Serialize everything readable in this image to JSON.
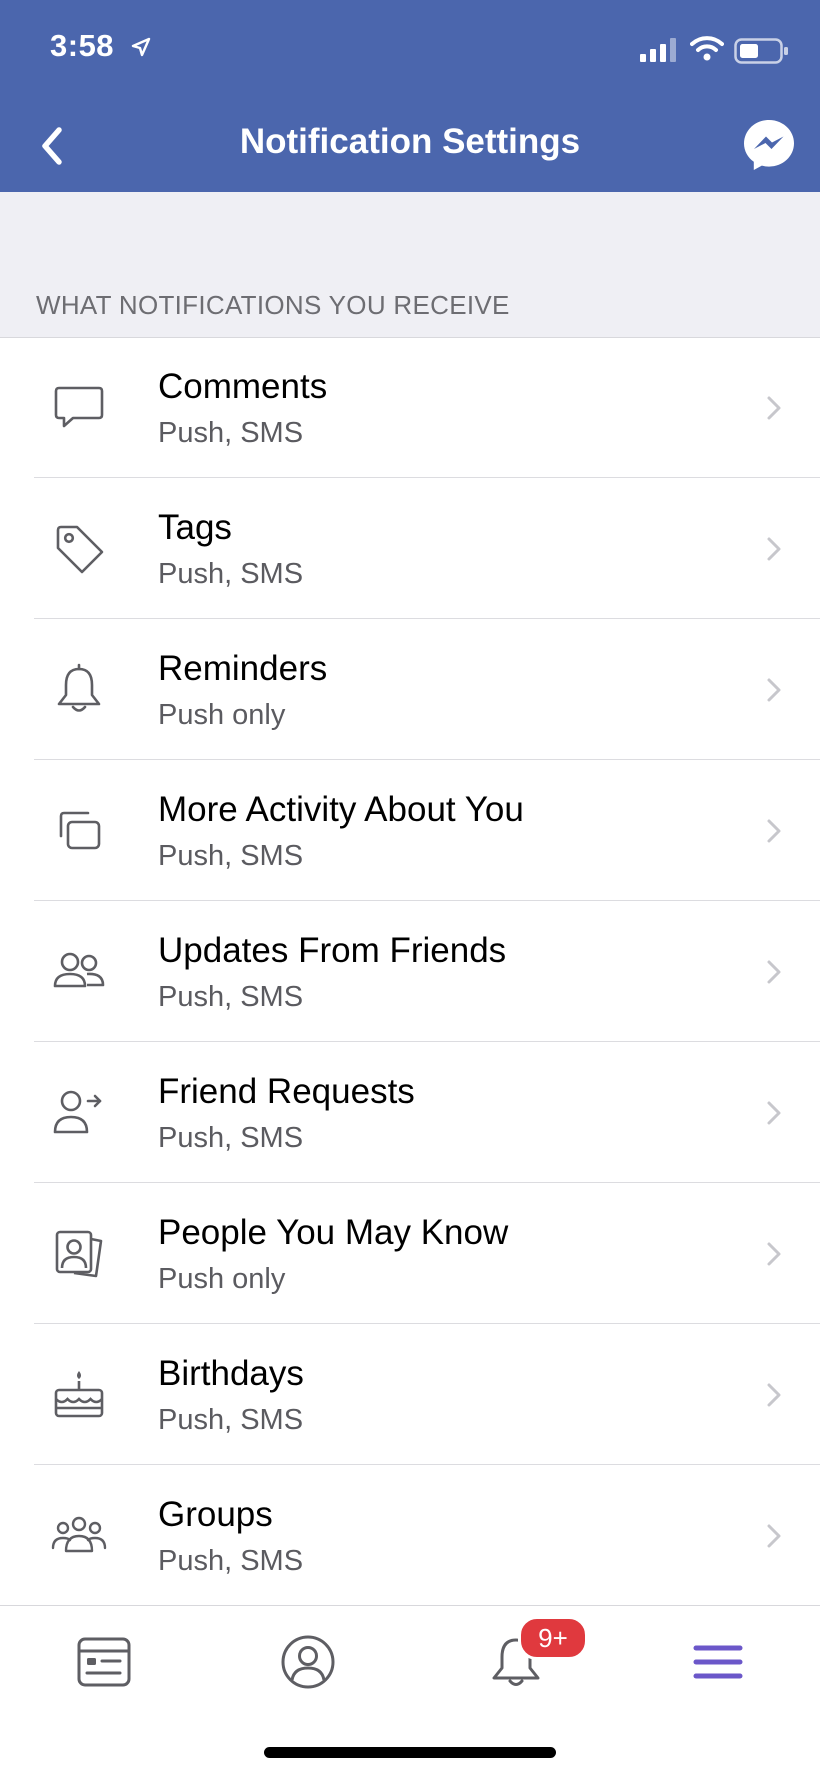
{
  "status_bar": {
    "time": "3:58"
  },
  "header": {
    "title": "Notification Settings"
  },
  "section": {
    "header": "WHAT NOTIFICATIONS YOU RECEIVE"
  },
  "items": [
    {
      "title": "Comments",
      "subtitle": "Push, SMS",
      "icon": "comment-icon"
    },
    {
      "title": "Tags",
      "subtitle": "Push, SMS",
      "icon": "tag-icon"
    },
    {
      "title": "Reminders",
      "subtitle": "Push only",
      "icon": "bell-icon"
    },
    {
      "title": "More Activity About You",
      "subtitle": "Push, SMS",
      "icon": "activity-icon"
    },
    {
      "title": "Updates From Friends",
      "subtitle": "Push, SMS",
      "icon": "friends-icon"
    },
    {
      "title": "Friend Requests",
      "subtitle": "Push, SMS",
      "icon": "friend-request-icon"
    },
    {
      "title": "People You May Know",
      "subtitle": "Push only",
      "icon": "people-you-may-know-icon"
    },
    {
      "title": "Birthdays",
      "subtitle": "Push, SMS",
      "icon": "cake-icon"
    },
    {
      "title": "Groups",
      "subtitle": "Push, SMS",
      "icon": "groups-icon"
    }
  ],
  "tab_bar": {
    "badge": "9+",
    "tabs": [
      "news-feed-icon",
      "profile-icon",
      "notifications-icon",
      "menu-icon"
    ]
  },
  "colors": {
    "header_bg": "#4b66ad",
    "badge": "#e0393e",
    "menu_active": "#6b57c9",
    "section_bg": "#efeff4"
  }
}
